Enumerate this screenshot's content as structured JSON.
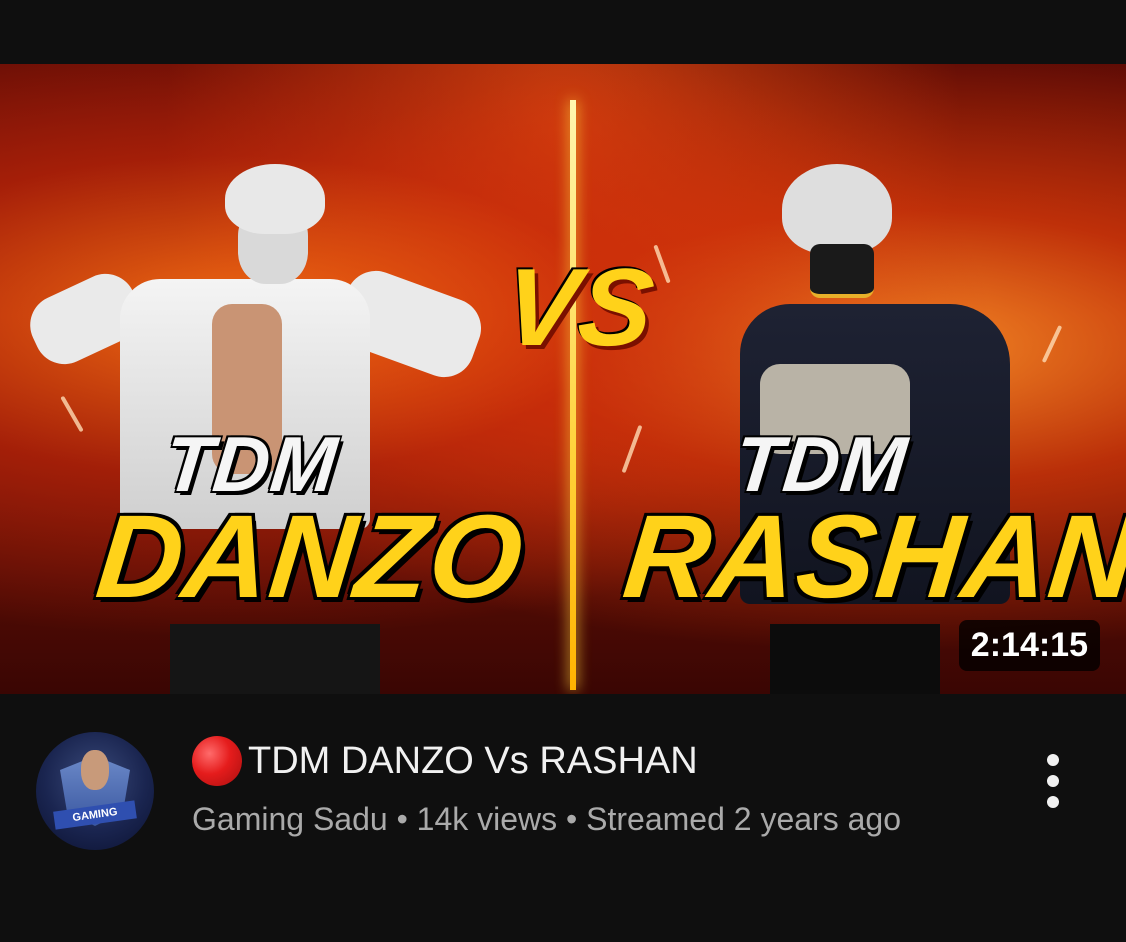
{
  "video": {
    "thumbnail": {
      "left_tag": "TDM",
      "left_name": "DANZO",
      "vs": "VS",
      "right_tag": "TDM",
      "right_name": "RASHAN",
      "duration": "2:14:15"
    },
    "title": "TDM DANZO Vs RASHAN",
    "live_icon": "red-circle-icon",
    "channel": "Gaming Sadu",
    "separator": "•",
    "views": "14k views",
    "streamed": "Streamed 2 years ago",
    "avatar_banner": "GAMING"
  },
  "colors": {
    "background": "#0f0f0f",
    "title": "#f1f1f1",
    "subtitle": "#aaaaaa",
    "live": "#e51c1c"
  }
}
